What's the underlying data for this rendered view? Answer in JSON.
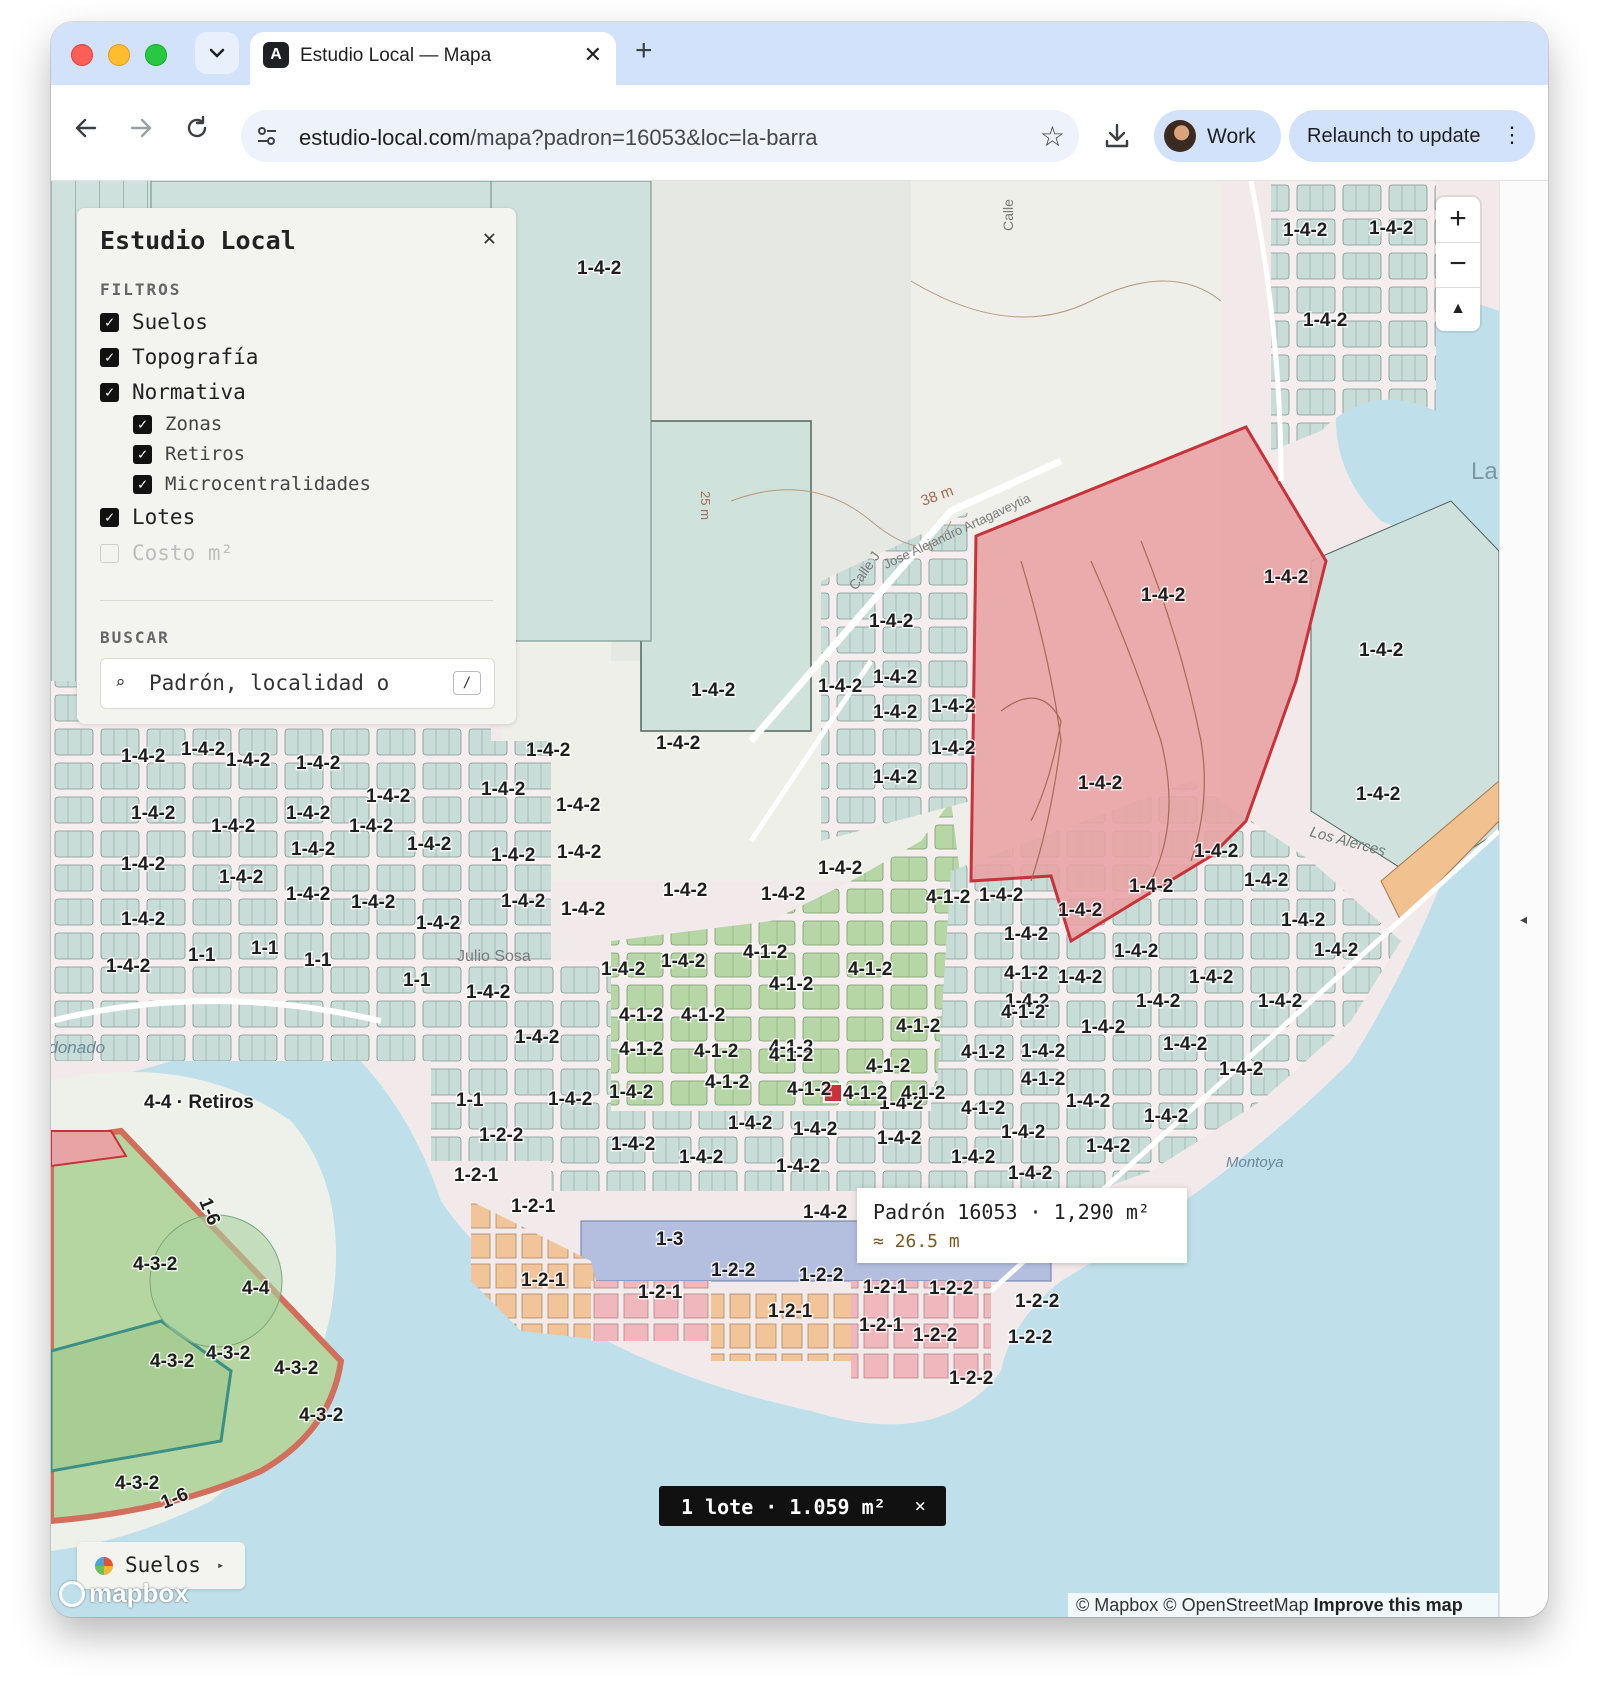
{
  "browser": {
    "tab_title": "Estudio Local — Mapa",
    "tab_close": "✕",
    "new_tab": "+",
    "url_host": "estudio-local.com",
    "url_path": "/mapa?padron=16053&loc=la-barra",
    "profile": "Work",
    "relaunch": "Relaunch to update"
  },
  "panel": {
    "title": "Estudio Local",
    "close": "✕",
    "filters_title": "FILTROS",
    "filters": [
      {
        "label": "Suelos",
        "checked": true
      },
      {
        "label": "Topografía",
        "checked": true
      },
      {
        "label": "Normativa",
        "checked": true
      },
      {
        "label": "Zonas",
        "checked": true
      },
      {
        "label": "Retiros",
        "checked": true
      },
      {
        "label": "Microcentralidades",
        "checked": true
      },
      {
        "label": "Lotes",
        "checked": true
      },
      {
        "label": "Costo m²",
        "checked": false
      }
    ],
    "search_title": "BUSCAR",
    "search_placeholder": "Padrón, localidad o",
    "search_shortcut": "/"
  },
  "map": {
    "zoom_in": "+",
    "zoom_out": "−",
    "compass": "▲",
    "tooltip_line1": "Padrón 16053 · 1,290 m²",
    "tooltip_line2": "≈ 26.5 m",
    "selection": "1 lote · 1.059 m²",
    "selection_close": "×",
    "layer_button": "Suelos",
    "layer_arrow": "▸",
    "logo": "mapbox",
    "attribution_a": "© Mapbox © OpenStreetMap",
    "attribution_b": "Improve this map",
    "place_labels": [
      "Maldonado",
      "Montoya",
      "Los Alerces",
      "La",
      "Calle J",
      "Calle",
      "38 m",
      "25 m",
      "Julio Sosa",
      "Jose Alejandro Artagaveytia"
    ],
    "zone_labels": [
      "1-1",
      "1-2-1",
      "1-2-2",
      "1-3",
      "1-4-2",
      "1-6",
      "4-1-2",
      "4-3-2",
      "4-4",
      "4-4 · Retiros"
    ],
    "colors": {
      "water": "#bfe0ea",
      "zone_residential": "#cfe2dd",
      "zone_green": "#b5d6a0",
      "zone_selected": "#e8a3a5",
      "zone_orange": "#f1c28f",
      "zone_pink": "#f0b6bc",
      "zone_blue": "#b4bfe0",
      "accent_red": "#c8323a"
    }
  }
}
